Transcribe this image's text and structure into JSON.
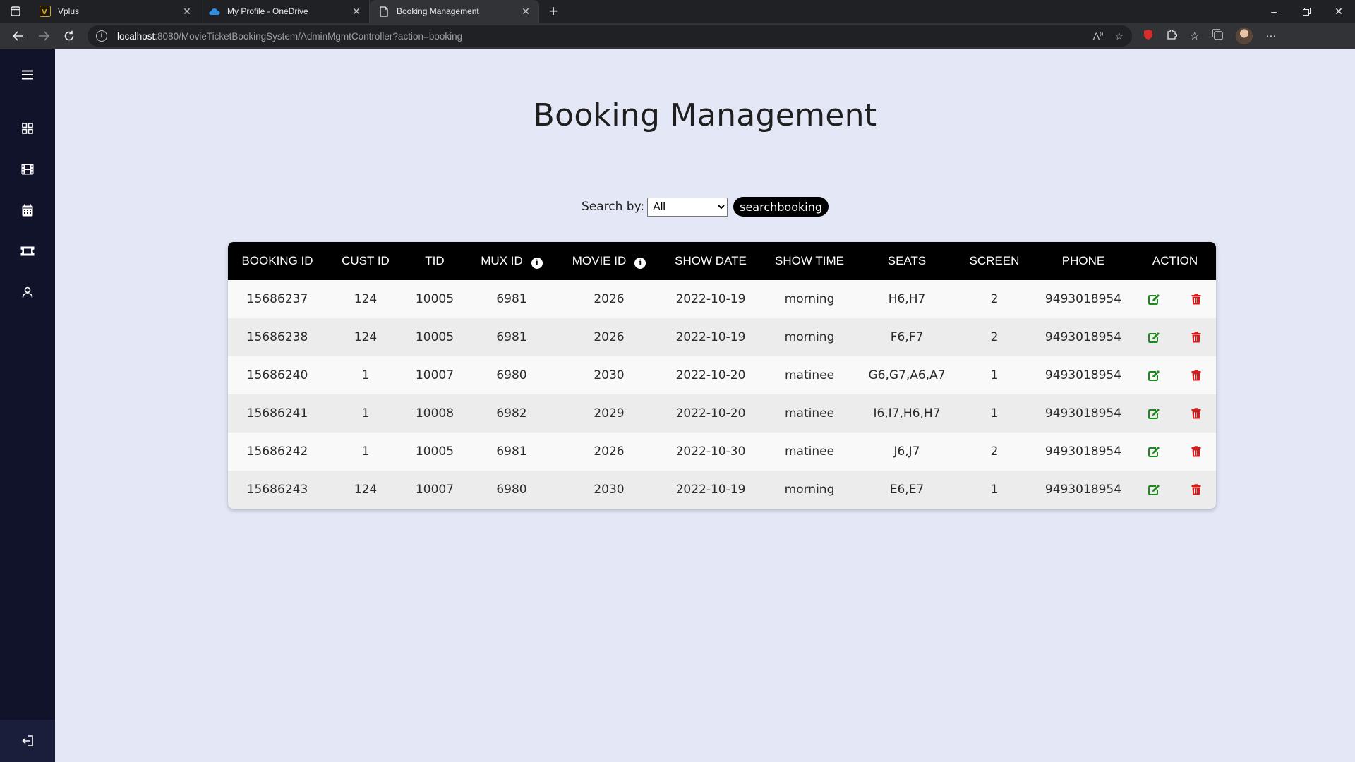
{
  "browser": {
    "tabs": [
      {
        "label": "Vplus",
        "icon": "vplus-favicon"
      },
      {
        "label": "My Profile - OneDrive",
        "icon": "onedrive-cloud-icon"
      },
      {
        "label": "Booking Management",
        "icon": "page-icon",
        "active": true
      }
    ],
    "url_host": "localhost",
    "url_rest": ":8080/MovieTicketBookingSystem/AdminMgmtController?action=booking"
  },
  "sidebar": {
    "items": [
      "menu-icon",
      "dashboard-icon",
      "film-icon",
      "calendar-icon",
      "ticket-icon",
      "user-icon"
    ],
    "logout": "logout-icon"
  },
  "page": {
    "title": "Booking Management",
    "search_label": "Search by:",
    "search_selected": "All",
    "search_button": "searchbooking"
  },
  "table": {
    "headers": [
      "BOOKING ID",
      "CUST ID",
      "TID",
      "MUX ID",
      "MOVIE ID",
      "SHOW DATE",
      "SHOW TIME",
      "SEATS",
      "SCREEN",
      "PHONE",
      "ACTION"
    ],
    "rows": [
      {
        "booking_id": "15686237",
        "cust_id": "124",
        "tid": "10005",
        "mux_id": "6981",
        "movie_id": "2026",
        "show_date": "2022-10-19",
        "show_time": "morning",
        "seats": "H6,H7",
        "screen": "2",
        "phone": "9493018954"
      },
      {
        "booking_id": "15686238",
        "cust_id": "124",
        "tid": "10005",
        "mux_id": "6981",
        "movie_id": "2026",
        "show_date": "2022-10-19",
        "show_time": "morning",
        "seats": "F6,F7",
        "screen": "2",
        "phone": "9493018954"
      },
      {
        "booking_id": "15686240",
        "cust_id": "1",
        "tid": "10007",
        "mux_id": "6980",
        "movie_id": "2030",
        "show_date": "2022-10-20",
        "show_time": "matinee",
        "seats": "G6,G7,A6,A7",
        "screen": "1",
        "phone": "9493018954"
      },
      {
        "booking_id": "15686241",
        "cust_id": "1",
        "tid": "10008",
        "mux_id": "6982",
        "movie_id": "2029",
        "show_date": "2022-10-20",
        "show_time": "matinee",
        "seats": "I6,I7,H6,H7",
        "screen": "1",
        "phone": "9493018954"
      },
      {
        "booking_id": "15686242",
        "cust_id": "1",
        "tid": "10005",
        "mux_id": "6981",
        "movie_id": "2026",
        "show_date": "2022-10-30",
        "show_time": "matinee",
        "seats": "J6,J7",
        "screen": "2",
        "phone": "9493018954"
      },
      {
        "booking_id": "15686243",
        "cust_id": "124",
        "tid": "10007",
        "mux_id": "6980",
        "movie_id": "2030",
        "show_date": "2022-10-19",
        "show_time": "morning",
        "seats": "E6,E7",
        "screen": "1",
        "phone": "9493018954"
      }
    ]
  },
  "colors": {
    "sidebar_bg": "#11132b",
    "page_bg": "#e3e7f6",
    "header_bg": "#000000",
    "edit": "#1e8a1e",
    "delete": "#d91a1a"
  }
}
